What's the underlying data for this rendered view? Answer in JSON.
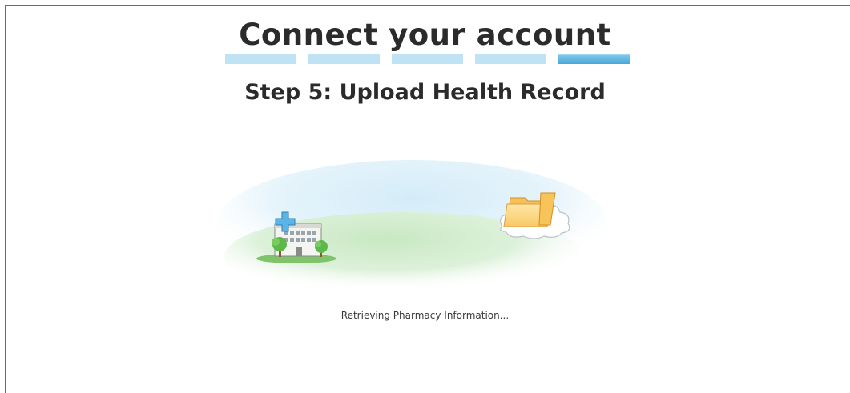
{
  "page": {
    "title": "Connect your account",
    "step_title": "Step 5: Upload Health Record",
    "status": "Retrieving Pharmacy Information..."
  },
  "progress": {
    "current_step": 5,
    "total_steps": 5
  },
  "colors": {
    "frame_border": "#3a78b8",
    "progress_inactive": "#bfe2f4",
    "progress_active": "#4aa8d8",
    "text": "#2b2b2b"
  },
  "icons": [
    "hospital-icon",
    "cloud-icon",
    "folder-icon"
  ]
}
